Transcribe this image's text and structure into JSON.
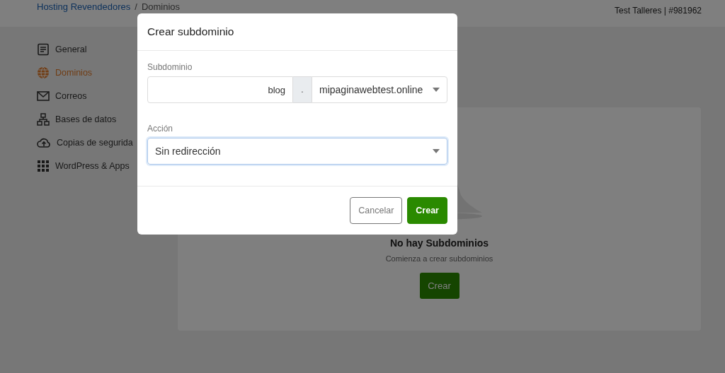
{
  "header": {
    "breadcrumb": [
      {
        "label": "Hosting Revendedores",
        "kind": "link"
      },
      {
        "label": "Dominios",
        "kind": "current"
      }
    ],
    "separator": "/",
    "account": "Test Talleres | #981962"
  },
  "sidebar": {
    "items": [
      {
        "label": "General",
        "selected": false
      },
      {
        "label": "Dominios",
        "selected": true
      },
      {
        "label": "Correos",
        "selected": false
      },
      {
        "label": "Bases de datos",
        "selected": false
      },
      {
        "label": "Copias de segurida",
        "selected": false
      },
      {
        "label": "WordPress & Apps",
        "selected": false
      }
    ]
  },
  "empty_state": {
    "title": "No hay Subdominios",
    "subtitle": "Comienza a crear subdominios",
    "button": "Crear"
  },
  "modal": {
    "title": "Crear subdominio",
    "subdomain_label": "Subdominio",
    "subdomain_value": "blog",
    "separator": ".",
    "domain": "mipaginawebtest.online",
    "action_label": "Acción",
    "action_value": "Sin redirección",
    "action_focused": true,
    "buttons": [
      {
        "label": "Cancelar",
        "kind": "secondary"
      },
      {
        "label": "Crear",
        "kind": "primary"
      }
    ]
  }
}
